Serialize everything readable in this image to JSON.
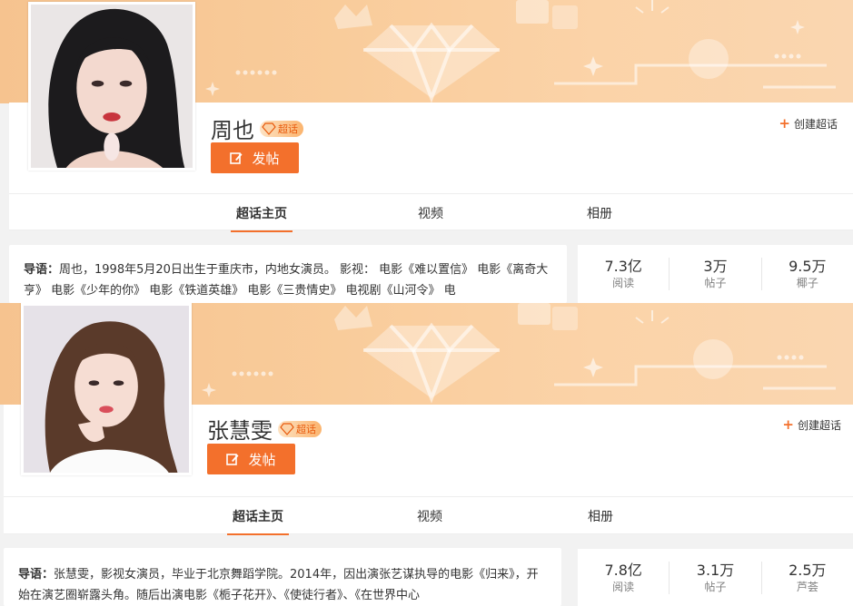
{
  "cards": [
    {
      "name": "周也",
      "badge": "超话",
      "post_label": "发帖",
      "create_label": "创建超话",
      "tabs": [
        "超话主页",
        "视频",
        "相册"
      ],
      "intro_label": "导语：",
      "intro_text": "周也，1998年5月20日出生于重庆市，内地女演员。 影视： 电影《难以置信》 电影《离奇大亨》 电影《少年的你》 电影《铁道英雄》 电影《三贵情史》 电视剧《山河令》 电",
      "stats": [
        {
          "num": "7.3亿",
          "label": "阅读"
        },
        {
          "num": "3万",
          "label": "帖子"
        },
        {
          "num": "9.5万",
          "label": "椰子"
        }
      ]
    },
    {
      "name": "张慧雯",
      "badge": "超话",
      "post_label": "发帖",
      "create_label": "创建超话",
      "tabs": [
        "超话主页",
        "视频",
        "相册"
      ],
      "intro_label": "导语：",
      "intro_text": "张慧雯，影视女演员，毕业于北京舞蹈学院。2014年，因出演张艺谋执导的电影《归来》，开始在演艺圈崭露头角。随后出演电影《栀子花开》、《使徒行者》、《在世界中心",
      "stats": [
        {
          "num": "7.8亿",
          "label": "阅读"
        },
        {
          "num": "3.1万",
          "label": "帖子"
        },
        {
          "num": "2.5万",
          "label": "芦荟"
        }
      ]
    }
  ],
  "colors": {
    "accent": "#f3702c",
    "banner": "#f9cc9b"
  },
  "icons": {
    "post": "edit-icon",
    "create": "plus-icon",
    "badge": "diamond-icon"
  }
}
